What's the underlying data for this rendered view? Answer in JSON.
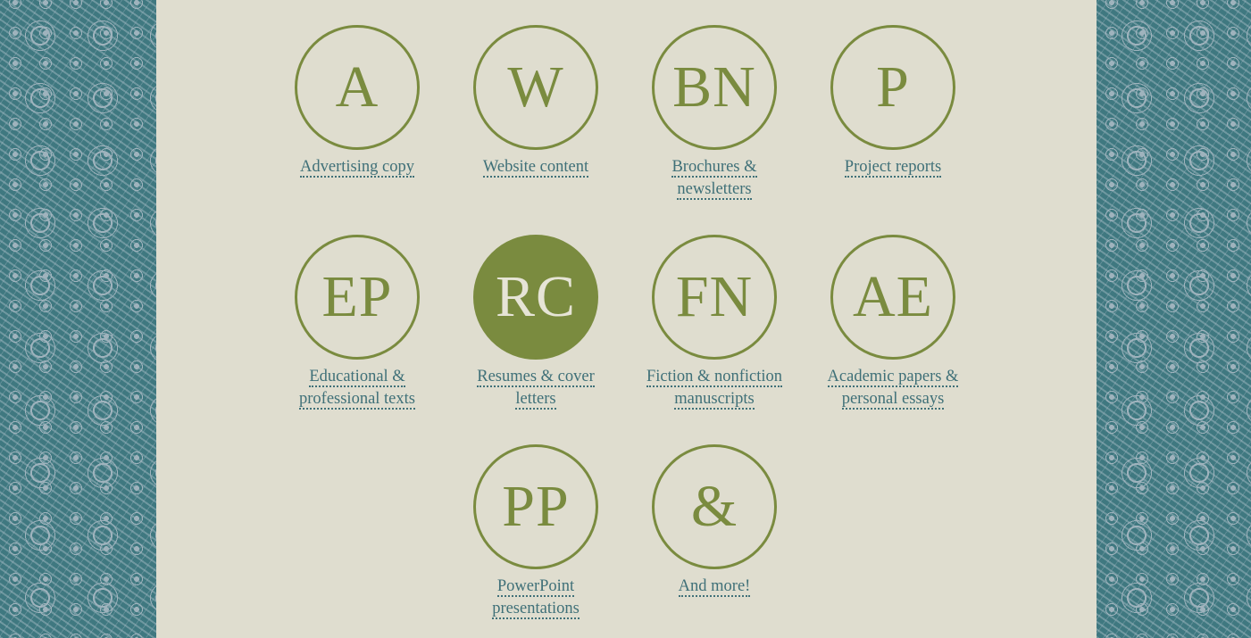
{
  "services": [
    {
      "initials": "A",
      "label_lines": [
        "Advertising copy"
      ]
    },
    {
      "initials": "W",
      "label_lines": [
        "Website content"
      ]
    },
    {
      "initials": "BN",
      "label_lines": [
        "Brochures &",
        "newsletters"
      ]
    },
    {
      "initials": "P",
      "label_lines": [
        "Project reports"
      ]
    },
    {
      "initials": "EP",
      "label_lines": [
        "Educational &",
        "professional texts"
      ]
    },
    {
      "initials": "RC",
      "label_lines": [
        "Resumes & cover",
        "letters"
      ],
      "active": true
    },
    {
      "initials": "FN",
      "label_lines": [
        "Fiction & nonfiction",
        "manuscripts"
      ]
    },
    {
      "initials": "AE",
      "label_lines": [
        "Academic papers &",
        "personal essays"
      ]
    },
    {
      "initials": "PP",
      "label_lines": [
        "PowerPoint",
        "presentations"
      ]
    },
    {
      "initials": "&",
      "label_lines": [
        "And more!"
      ]
    }
  ],
  "colors": {
    "accent_olive": "#7a8b3f",
    "link_teal": "#3f7078",
    "panel_background": "#dfddcf",
    "pattern_teal": "#3f7880"
  }
}
